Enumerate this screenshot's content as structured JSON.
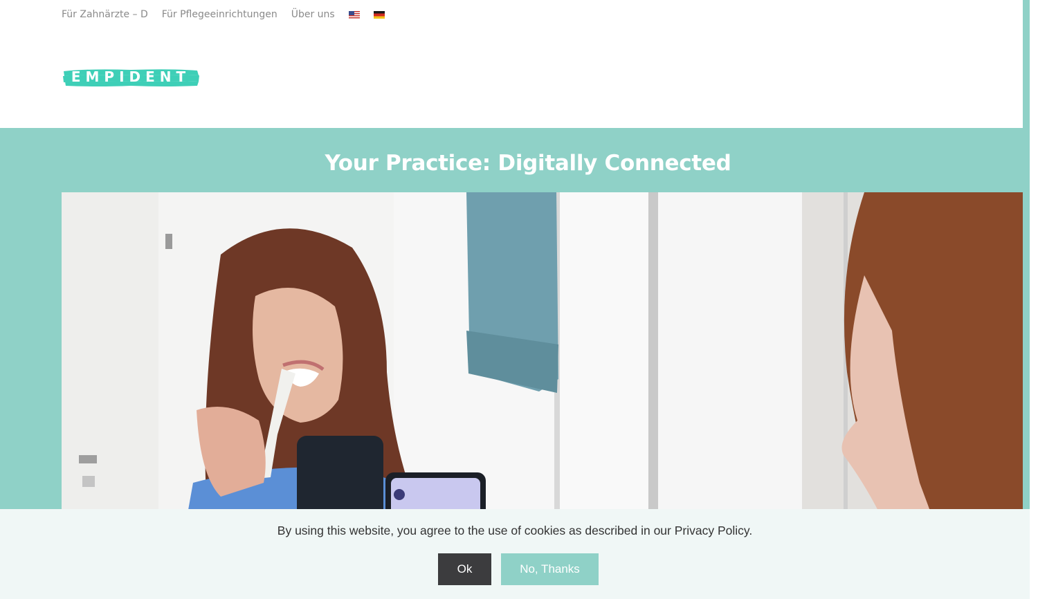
{
  "topnav": {
    "links": [
      "Für Zahnärzte – D",
      "Für Pflegeeinrichtungen",
      "Über uns"
    ]
  },
  "logo": {
    "text": "EMPIDENT",
    "color": "#3ecfb7"
  },
  "hero": {
    "title": "Your Practice: Digitally Connected",
    "background": "#8fd1c7"
  },
  "cookie": {
    "message": "By using this website, you agree to the use of cookies as described in our Privacy Policy.",
    "ok_label": "Ok",
    "decline_label": "No, Thanks"
  },
  "colors": {
    "accent": "#8fd1c7",
    "dark_button": "#3c3c3e",
    "nav_text": "#8a8a8a"
  }
}
